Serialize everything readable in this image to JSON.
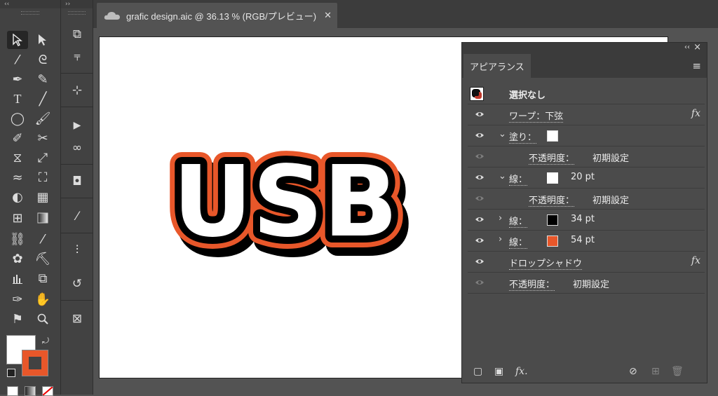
{
  "left_panel": {
    "collapse_label": "‹‹"
  },
  "dock_panel": {
    "collapse_label": "››"
  },
  "document_tab": {
    "title": "grafic design.aic @ 36.13 % (RGB/プレビュー)",
    "close_icon": "close-icon"
  },
  "artwork": {
    "text": "USB",
    "outer_stroke_color": "#e8572a",
    "shadow_color": "#000000",
    "fill_color": "#ffffff"
  },
  "colors": {
    "fill_swatch": "#ffffff",
    "stroke_swatch": "#e8572a",
    "accent": "#e8572a"
  },
  "appearance": {
    "tab_label": "アピアランス",
    "header_controls": {
      "collapse": "‹‹",
      "close": "×"
    },
    "rows": [
      {
        "label": "選択なし"
      },
      {
        "label": "ワープ：下弦"
      },
      {
        "label": "塗り："
      },
      {
        "label": "不透明度：",
        "value": "初期設定"
      },
      {
        "label": "線：",
        "value": "20 pt"
      },
      {
        "label": "不透明度：",
        "value": "初期設定"
      },
      {
        "label": "線：",
        "value": "34 pt"
      },
      {
        "label": "線：",
        "value": "54 pt"
      },
      {
        "label": "ドロップシャドウ"
      },
      {
        "label": "不透明度：",
        "value": "初期設定"
      }
    ],
    "fx_label": "fx",
    "footer_fx": "fx."
  }
}
